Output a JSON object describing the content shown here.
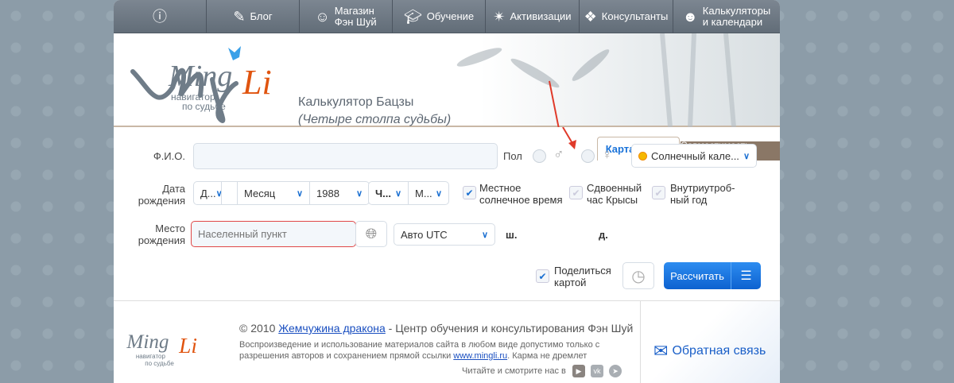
{
  "nav": {
    "items": [
      {
        "label": "",
        "icon": "info-icon"
      },
      {
        "label": "Блог",
        "icon": "blog-icon"
      },
      {
        "label": "Магазин\nФэн Шуй",
        "icon": "cat-icon"
      },
      {
        "label": "Обучение",
        "icon": "graduation-cap-icon"
      },
      {
        "label": "Активизации",
        "icon": "magic-wand-icon"
      },
      {
        "label": "Консультанты",
        "icon": "knot-icon"
      },
      {
        "label": "Калькуляторы\nи календари",
        "icon": "calculator-icon"
      }
    ]
  },
  "header": {
    "logo_text": "Ming Li",
    "logo_sub1": "навигатор",
    "logo_sub2": "по судьбе",
    "title": "Калькулятор Бацзы",
    "subtitle": "(Четыре столпа судьбы)"
  },
  "tabs": {
    "active": "Карта Бацзы",
    "other": "Совместимость Бацзы"
  },
  "form": {
    "name_label": "Ф.И.О.",
    "name_value": "",
    "gender_label": "Пол",
    "calendar": "Солнечный кале...",
    "date_label": "Дата рождения",
    "day": "Д...",
    "month": "Месяц",
    "year": "1988",
    "hour": "Ч...",
    "minute": "М...",
    "local_solar": "Местное солнечное время",
    "local_solar_checked": true,
    "double_rat": "Сдвоенный час Крысы",
    "double_rat_checked": false,
    "prenatal": "Внутриутроб-ный год",
    "prenatal_checked": false,
    "place_label": "Место рождения",
    "place_placeholder": "Населенный пункт",
    "utc": "Авто UTC",
    "lat": "ш.",
    "lon": "д.",
    "share": "Поделиться картой",
    "share_checked": true,
    "calculate": "Рассчитать"
  },
  "footer": {
    "copyright": "© 2010 ",
    "company_link": "Жемчужина дракона",
    "copyright_rest": " - Центр обучения и консультирования Фэн Шуй",
    "notice": "Воспроизведение и использование материалов сайта в любом виде допустимо только с разрешения авторов и сохранением прямой ссылки ",
    "site_link": "www.mingli.ru",
    "notice_end": ". Карма не дремлет",
    "social": "Читайте и смотрите нас в",
    "feedback": "Обратная связь"
  },
  "colors": {
    "accent": "#1a73d9",
    "logo_orange": "#e0540f",
    "nav": "#6b7681"
  }
}
